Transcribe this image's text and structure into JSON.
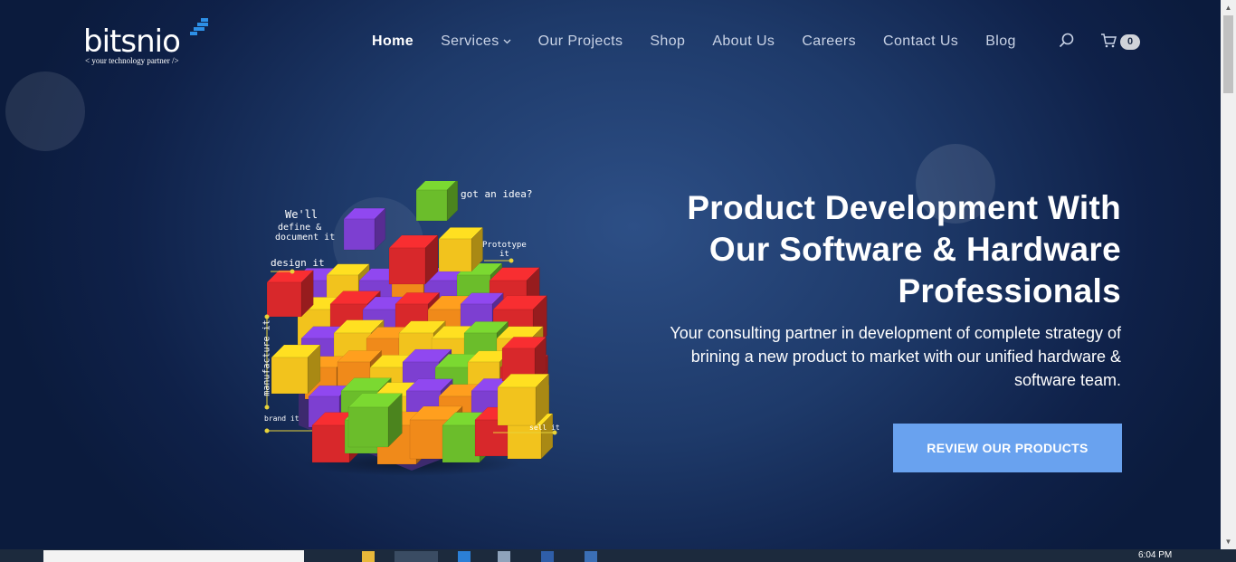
{
  "brand": {
    "name": "bitsnio",
    "tagline": "< your technology partner />",
    "accent": "#2d8fe6"
  },
  "nav": {
    "items": [
      {
        "label": "Home",
        "active": true
      },
      {
        "label": "Services",
        "has_dropdown": true
      },
      {
        "label": "Our Projects"
      },
      {
        "label": "Shop"
      },
      {
        "label": "About Us"
      },
      {
        "label": "Careers"
      },
      {
        "label": "Contact Us"
      },
      {
        "label": "Blog"
      }
    ],
    "search_icon": "search-icon",
    "cart_icon": "cart-icon",
    "cart_count": "0"
  },
  "hero": {
    "title_bold": "Product Development",
    "title_rest_1": " With",
    "title_line_2": "Our Software & Hardware",
    "title_line_3": "Professionals",
    "subtitle_1": "Your consulting partner in development of complete strategy of",
    "subtitle_2": "brining a new product to market with our unified hardware &",
    "subtitle_3": "software team.",
    "cta_label": "REVIEW OUR PRODUCTS",
    "cta_color": "#69a2ef"
  },
  "illustration": {
    "labels": {
      "idea": "got an idea?",
      "define_1": "We'll",
      "define_2": "define &",
      "define_3": "document it",
      "design": "design it",
      "prototype_1": "Prototype",
      "prototype_2": "it",
      "manufacture": "manufacture it",
      "brand": "brand it",
      "sell": "sell it"
    }
  },
  "taskbar": {
    "clock": "6:04 PM"
  }
}
